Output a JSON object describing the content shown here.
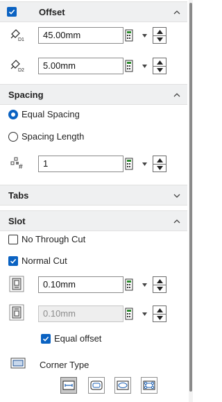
{
  "offset": {
    "title": "Offset",
    "checked": true,
    "d1_value": "45.00mm",
    "d2_value": "5.00mm",
    "d1_icon": "distance-d1-icon",
    "d2_icon": "distance-d2-icon"
  },
  "spacing": {
    "title": "Spacing",
    "equal_spacing_label": "Equal Spacing",
    "spacing_length_label": "Spacing Length",
    "selected": "Equal Spacing",
    "instances_value": "1",
    "instances_icon": "instance-count-icon"
  },
  "tabs": {
    "title": "Tabs",
    "collapsed": true
  },
  "slot": {
    "title": "Slot",
    "no_through_cut_label": "No Through Cut",
    "no_through_cut_checked": false,
    "normal_cut_label": "Normal Cut",
    "normal_cut_checked": true,
    "offset1_value": "0.10mm",
    "offset2_value": "0.10mm",
    "offset2_disabled": true,
    "equal_offset_label": "Equal offset",
    "equal_offset_checked": true,
    "corner_type_label": "Corner Type",
    "corner_types": [
      "rectangular-corner-icon",
      "rounded-corner-icon",
      "capsule-corner-icon",
      "relief-corner-icon"
    ],
    "corner_selected": 0
  },
  "colors": {
    "accent": "#0a62c2",
    "header_bg": "#eff0f1",
    "disabled_bg": "#eeeeee"
  }
}
